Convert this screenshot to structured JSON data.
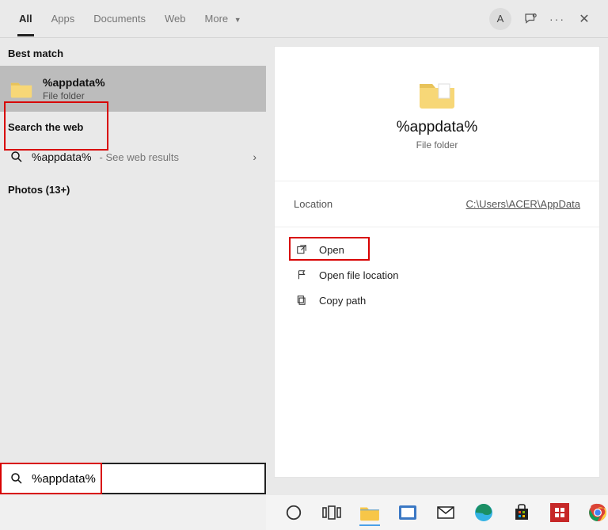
{
  "tabs": {
    "all": "All",
    "apps": "Apps",
    "documents": "Documents",
    "web": "Web",
    "more": "More"
  },
  "avatar_letter": "A",
  "left": {
    "best_match_label": "Best match",
    "result_title": "%appdata%",
    "result_subtitle": "File folder",
    "search_web_label": "Search the web",
    "web_query": "%appdata%",
    "web_hint": " - See web results",
    "photos_label": "Photos (13+)"
  },
  "details": {
    "title": "%appdata%",
    "subtitle": "File folder",
    "location_label": "Location",
    "location_path": "C:\\Users\\ACER\\AppData",
    "actions": {
      "open": "Open",
      "open_file_location": "Open file location",
      "copy_path": "Copy path"
    }
  },
  "search_value": "%appdata%"
}
